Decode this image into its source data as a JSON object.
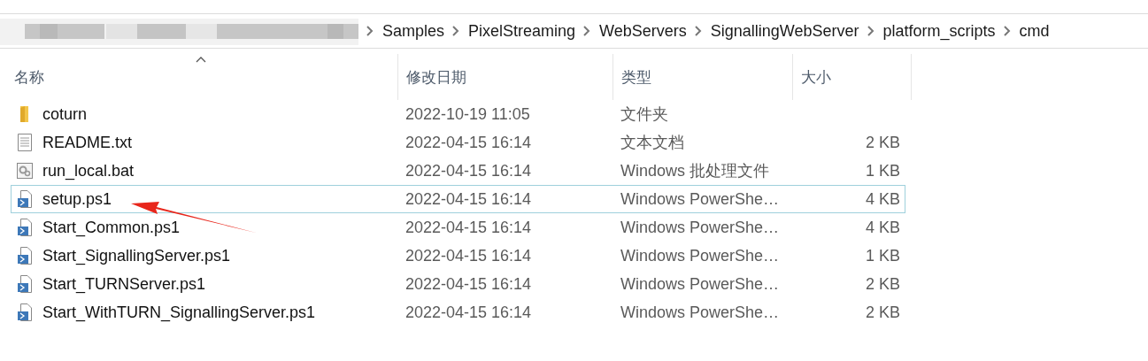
{
  "address_bar": {
    "path": [
      "Samples",
      "PixelStreaming",
      "WebServers",
      "SignallingWebServer",
      "platform_scripts",
      "cmd"
    ]
  },
  "table": {
    "columns": [
      "名称",
      "修改日期",
      "类型",
      "大小"
    ],
    "rows": [
      {
        "kind": "folder",
        "name": "coturn",
        "date": "2022-10-19 11:05",
        "type": "文件夹",
        "selected": false
      },
      {
        "kind": "text",
        "name": "README.txt",
        "date": "2022-04-15 16:14",
        "type": "文本文档",
        "size": "2 KB",
        "selected": false
      },
      {
        "kind": "batch",
        "name": "run_local.bat",
        "date": "2022-04-15 16:14",
        "type": "Windows 批处理文件",
        "size": "1 KB",
        "selected": false
      },
      {
        "kind": "script",
        "name": "setup.ps1",
        "date": "2022-04-15 16:14",
        "type": "Windows PowerShe…",
        "size": "4 KB",
        "selected": true
      },
      {
        "kind": "script",
        "name": "Start_Common.ps1",
        "date": "2022-04-15 16:14",
        "type": "Windows PowerShe…",
        "size": "4 KB",
        "selected": false
      },
      {
        "kind": "script",
        "name": "Start_SignallingServer.ps1",
        "date": "2022-04-15 16:14",
        "type": "Windows PowerShe…",
        "size": "1 KB",
        "selected": false
      },
      {
        "kind": "script",
        "name": "Start_TURNServer.ps1",
        "date": "2022-04-15 16:14",
        "type": "Windows PowerShe…",
        "size": "2 KB",
        "selected": false
      },
      {
        "kind": "script",
        "name": "Start_WithTURN_SignallingServer.ps1",
        "date": "2022-04-15 16:14",
        "type": "Windows PowerShe…",
        "size": "2 KB",
        "selected": false
      }
    ]
  }
}
